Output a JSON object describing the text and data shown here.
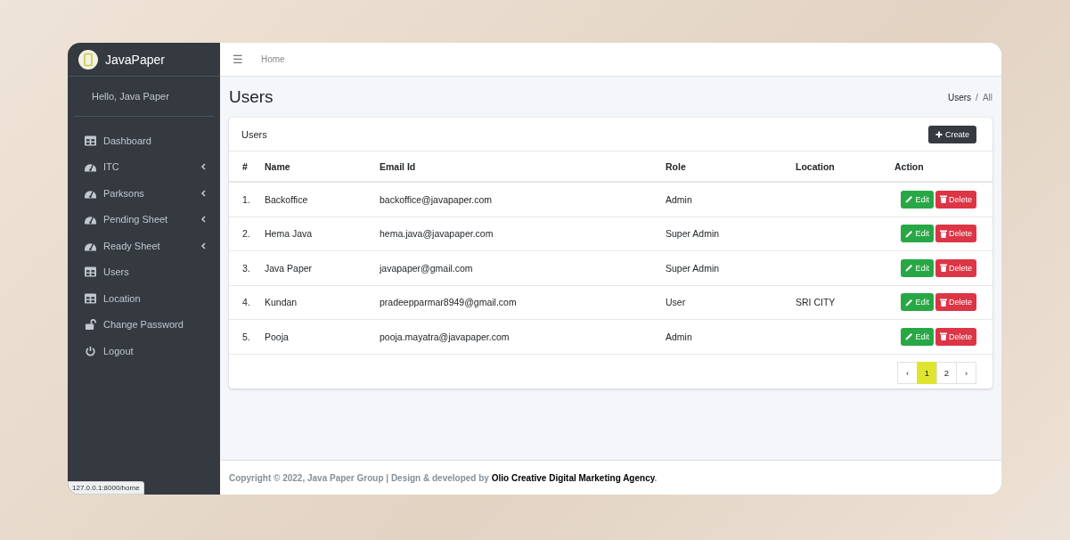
{
  "sidebar": {
    "brand": "JavaPaper",
    "greeting": "Hello, Java Paper",
    "items": [
      {
        "label": "Dashboard",
        "kind": "grid",
        "expandable": false
      },
      {
        "label": "ITC",
        "kind": "gauge",
        "expandable": true
      },
      {
        "label": "Parksons",
        "kind": "gauge",
        "expandable": true
      },
      {
        "label": "Pending Sheet",
        "kind": "gauge",
        "expandable": true
      },
      {
        "label": "Ready Sheet",
        "kind": "gauge",
        "expandable": true
      },
      {
        "label": "Users",
        "kind": "grid",
        "expandable": false
      },
      {
        "label": "Location",
        "kind": "grid",
        "expandable": false
      },
      {
        "label": "Change Password",
        "kind": "lock",
        "expandable": false
      },
      {
        "label": "Logout",
        "kind": "power",
        "expandable": false
      }
    ]
  },
  "topbar": {
    "menu_icon": "☰",
    "link": "Home"
  },
  "page": {
    "title": "Users",
    "breadcrumb": [
      "Users",
      "All"
    ],
    "breadcrumb_separator": "/"
  },
  "card": {
    "title": "Users",
    "create_button": "Create",
    "table": {
      "columns": [
        "#",
        "Name",
        "Email Id",
        "Role",
        "Location",
        "Action"
      ],
      "rows": [
        {
          "index": "1.",
          "name": "Backoffice",
          "email": "backoffice@javapaper.com",
          "role": "Admin",
          "location": "",
          "edit": "Edit",
          "delete": "Delete"
        },
        {
          "index": "2.",
          "name": "Hema Java",
          "email": "hema.java@javapaper.com",
          "role": "Super Admin",
          "location": "",
          "edit": "Edit",
          "delete": "Delete"
        },
        {
          "index": "3.",
          "name": "Java Paper",
          "email": "javapaper@gmail.com",
          "role": "Super Admin",
          "location": "",
          "edit": "Edit",
          "delete": "Delete"
        },
        {
          "index": "4.",
          "name": "Kundan",
          "email": "pradeepparmar8949@gmail.com",
          "role": "User",
          "location": "SRI CITY",
          "edit": "Edit",
          "delete": "Delete"
        },
        {
          "index": "5.",
          "name": "Pooja",
          "email": "pooja.mayatra@javapaper.com",
          "role": "Admin",
          "location": "",
          "edit": "Edit",
          "delete": "Delete"
        }
      ]
    },
    "pagination": [
      {
        "label": "‹",
        "selected": false
      },
      {
        "label": "1",
        "selected": true
      },
      {
        "label": "2",
        "selected": false
      },
      {
        "label": "›",
        "selected": false
      }
    ]
  },
  "footer": {
    "text": "Copyright © 2022, Java Paper Group | Design & developed by ",
    "link": "Olio Creative Digital Marketing Agency",
    "end": "."
  },
  "status_url": "127.0.0.1:8000/home"
}
